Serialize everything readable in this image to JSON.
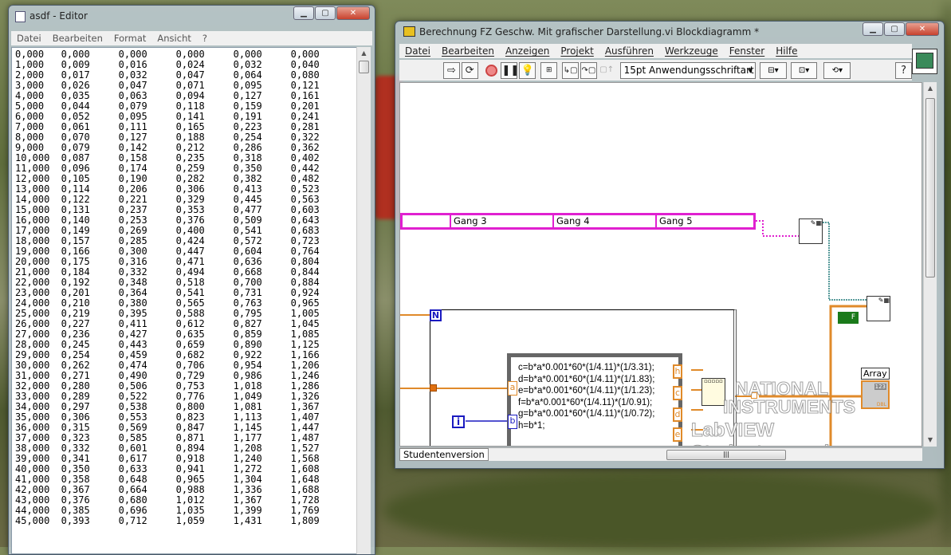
{
  "notepad": {
    "title": "asdf - Editor",
    "menu": [
      "Datei",
      "Bearbeiten",
      "Format",
      "Ansicht",
      "?"
    ],
    "rows": [
      [
        "0,000",
        "0,000",
        "0,000",
        "0,000",
        "0,000",
        "0,000"
      ],
      [
        "1,000",
        "0,009",
        "0,016",
        "0,024",
        "0,032",
        "0,040"
      ],
      [
        "2,000",
        "0,017",
        "0,032",
        "0,047",
        "0,064",
        "0,080"
      ],
      [
        "3,000",
        "0,026",
        "0,047",
        "0,071",
        "0,095",
        "0,121"
      ],
      [
        "4,000",
        "0,035",
        "0,063",
        "0,094",
        "0,127",
        "0,161"
      ],
      [
        "5,000",
        "0,044",
        "0,079",
        "0,118",
        "0,159",
        "0,201"
      ],
      [
        "6,000",
        "0,052",
        "0,095",
        "0,141",
        "0,191",
        "0,241"
      ],
      [
        "7,000",
        "0,061",
        "0,111",
        "0,165",
        "0,223",
        "0,281"
      ],
      [
        "8,000",
        "0,070",
        "0,127",
        "0,188",
        "0,254",
        "0,322"
      ],
      [
        "9,000",
        "0,079",
        "0,142",
        "0,212",
        "0,286",
        "0,362"
      ],
      [
        "10,000",
        "0,087",
        "0,158",
        "0,235",
        "0,318",
        "0,402"
      ],
      [
        "11,000",
        "0,096",
        "0,174",
        "0,259",
        "0,350",
        "0,442"
      ],
      [
        "12,000",
        "0,105",
        "0,190",
        "0,282",
        "0,382",
        "0,482"
      ],
      [
        "13,000",
        "0,114",
        "0,206",
        "0,306",
        "0,413",
        "0,523"
      ],
      [
        "14,000",
        "0,122",
        "0,221",
        "0,329",
        "0,445",
        "0,563"
      ],
      [
        "15,000",
        "0,131",
        "0,237",
        "0,353",
        "0,477",
        "0,603"
      ],
      [
        "16,000",
        "0,140",
        "0,253",
        "0,376",
        "0,509",
        "0,643"
      ],
      [
        "17,000",
        "0,149",
        "0,269",
        "0,400",
        "0,541",
        "0,683"
      ],
      [
        "18,000",
        "0,157",
        "0,285",
        "0,424",
        "0,572",
        "0,723"
      ],
      [
        "19,000",
        "0,166",
        "0,300",
        "0,447",
        "0,604",
        "0,764"
      ],
      [
        "20,000",
        "0,175",
        "0,316",
        "0,471",
        "0,636",
        "0,804"
      ],
      [
        "21,000",
        "0,184",
        "0,332",
        "0,494",
        "0,668",
        "0,844"
      ],
      [
        "22,000",
        "0,192",
        "0,348",
        "0,518",
        "0,700",
        "0,884"
      ],
      [
        "23,000",
        "0,201",
        "0,364",
        "0,541",
        "0,731",
        "0,924"
      ],
      [
        "24,000",
        "0,210",
        "0,380",
        "0,565",
        "0,763",
        "0,965"
      ],
      [
        "25,000",
        "0,219",
        "0,395",
        "0,588",
        "0,795",
        "1,005"
      ],
      [
        "26,000",
        "0,227",
        "0,411",
        "0,612",
        "0,827",
        "1,045"
      ],
      [
        "27,000",
        "0,236",
        "0,427",
        "0,635",
        "0,859",
        "1,085"
      ],
      [
        "28,000",
        "0,245",
        "0,443",
        "0,659",
        "0,890",
        "1,125"
      ],
      [
        "29,000",
        "0,254",
        "0,459",
        "0,682",
        "0,922",
        "1,166"
      ],
      [
        "30,000",
        "0,262",
        "0,474",
        "0,706",
        "0,954",
        "1,206"
      ],
      [
        "31,000",
        "0,271",
        "0,490",
        "0,729",
        "0,986",
        "1,246"
      ],
      [
        "32,000",
        "0,280",
        "0,506",
        "0,753",
        "1,018",
        "1,286"
      ],
      [
        "33,000",
        "0,289",
        "0,522",
        "0,776",
        "1,049",
        "1,326"
      ],
      [
        "34,000",
        "0,297",
        "0,538",
        "0,800",
        "1,081",
        "1,367"
      ],
      [
        "35,000",
        "0,306",
        "0,553",
        "0,823",
        "1,113",
        "1,407"
      ],
      [
        "36,000",
        "0,315",
        "0,569",
        "0,847",
        "1,145",
        "1,447"
      ],
      [
        "37,000",
        "0,323",
        "0,585",
        "0,871",
        "1,177",
        "1,487"
      ],
      [
        "38,000",
        "0,332",
        "0,601",
        "0,894",
        "1,208",
        "1,527"
      ],
      [
        "39,000",
        "0,341",
        "0,617",
        "0,918",
        "1,240",
        "1,568"
      ],
      [
        "40,000",
        "0,350",
        "0,633",
        "0,941",
        "1,272",
        "1,608"
      ],
      [
        "41,000",
        "0,358",
        "0,648",
        "0,965",
        "1,304",
        "1,648"
      ],
      [
        "42,000",
        "0,367",
        "0,664",
        "0,988",
        "1,336",
        "1,688"
      ],
      [
        "43,000",
        "0,376",
        "0,680",
        "1,012",
        "1,367",
        "1,728"
      ],
      [
        "44,000",
        "0,385",
        "0,696",
        "1,035",
        "1,399",
        "1,769"
      ],
      [
        "45,000",
        "0,393",
        "0,712",
        "1,059",
        "1,431",
        "1,809"
      ]
    ]
  },
  "labview": {
    "title": "Berechnung FZ Geschw. Mit grafischer Darstellung.vi Blockdiagramm *",
    "menu": [
      "Datei",
      "Bearbeiten",
      "Anzeigen",
      "Projekt",
      "Ausführen",
      "Werkzeuge",
      "Fenster",
      "Hilfe"
    ],
    "font_select": "15pt Anwendungsschriftart",
    "help_button": "?",
    "cluster_labels": [
      "Gang 3",
      "Gang 4",
      "Gang 5"
    ],
    "loop_count": "N",
    "loop_index": "i",
    "formula": [
      "c=b*a*0.001*60*(1/4.11)*(1/3.31);",
      "d=b*a*0.001*60*(1/4.11)*(1/1.83);",
      "e=b*a*0.001*60*(1/4.11)*(1/1.23);",
      "f=b*a*0.001*60*(1/4.11)*(1/0.91);",
      "g=b*a*0.001*60*(1/4.11)*(1/0.72);",
      "h=b*1;"
    ],
    "input_terms": [
      "a",
      "b"
    ],
    "output_terms": [
      "h",
      "c",
      "d",
      "e"
    ],
    "bool_const": "F",
    "array_label": "Array",
    "array_type": "DBL",
    "array_num": "123",
    "status": "Studentenversion",
    "watermark": [
      "NATIONAL",
      "INSTRUMENTS",
      "LabVIEW Studentenversion"
    ],
    "colors": {
      "cluster": "#e020d0",
      "orange_wire": "#e08a2a",
      "blue_wire": "#1a1ac0",
      "teal_wire": "#207a7a",
      "bool": "#1a7a1a"
    }
  }
}
